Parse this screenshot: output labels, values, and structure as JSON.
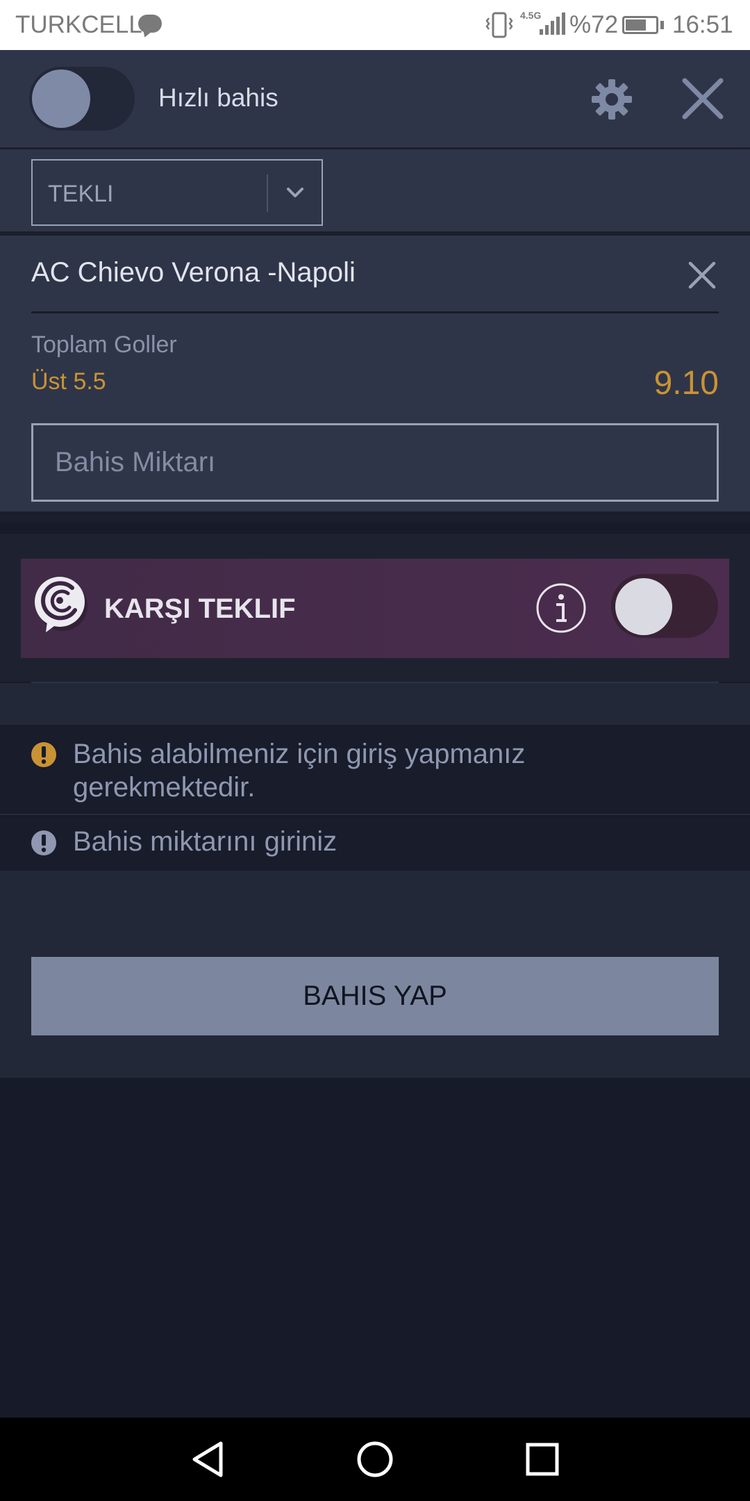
{
  "status_bar": {
    "carrier": "TURKCELL",
    "network_type": "4.5G",
    "battery_percent": "%72",
    "battery_level": 0.72,
    "time": "16:51",
    "icons": [
      "message-icon",
      "vibrate-icon",
      "signal-icon",
      "battery-icon"
    ]
  },
  "header": {
    "quick_bet_label": "Hızlı bahis",
    "quick_bet_enabled": false,
    "icons": [
      "settings-icon",
      "close-icon"
    ]
  },
  "bet_type": {
    "selected": "TEKLI"
  },
  "bet_card": {
    "match": "AC Chievo Verona -Napoli",
    "market": "Toplam Goller",
    "selection": "Üst 5.5",
    "odds": "9.10",
    "stake_placeholder": "Bahis Miktarı"
  },
  "counter_offer": {
    "label": "KARŞI TEKLIF",
    "enabled": false
  },
  "alerts": {
    "login_required": "Bahis alabilmeniz için giriş yapmanız gerekmektedir.",
    "enter_stake": "Bahis miktarını giriniz"
  },
  "actions": {
    "place_bet": "BAHIS YAP"
  },
  "colors": {
    "accent": "#c99334",
    "panel": "#2f3548",
    "background": "#171b29",
    "button": "#7c879f"
  }
}
